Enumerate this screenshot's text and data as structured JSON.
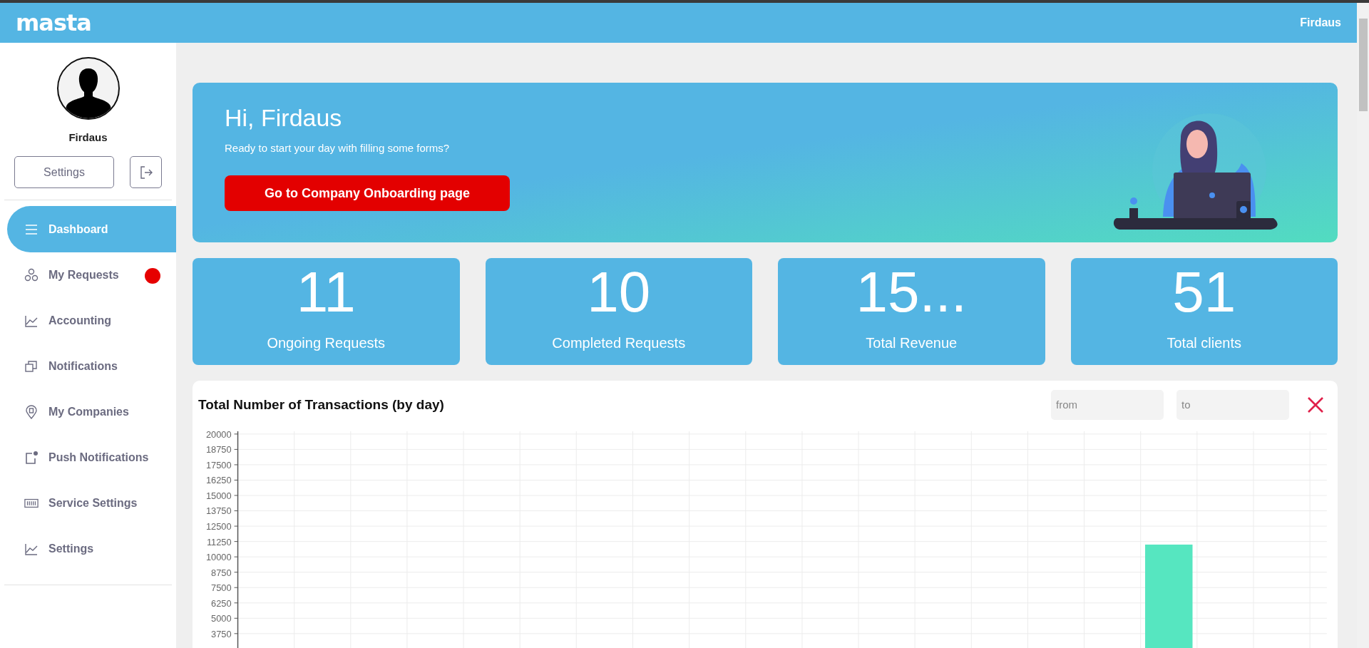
{
  "header": {
    "logo": "masta",
    "user_name": "Firdaus"
  },
  "profile": {
    "name": "Firdaus",
    "settings_button": "Settings"
  },
  "nav": [
    {
      "label": "Dashboard",
      "kind": "menu",
      "selected": true,
      "alert": false
    },
    {
      "label": "My Requests",
      "kind": "circles",
      "selected": false,
      "alert": true
    },
    {
      "label": "Accounting",
      "kind": "chart",
      "selected": false,
      "alert": false
    },
    {
      "label": "Notifications",
      "kind": "squares",
      "selected": false,
      "alert": false
    },
    {
      "label": "My Companies",
      "kind": "pin",
      "selected": false,
      "alert": false
    },
    {
      "label": "Push Notifications",
      "kind": "boxdot",
      "selected": false,
      "alert": false
    },
    {
      "label": "Service Settings",
      "kind": "barcode",
      "selected": false,
      "alert": false
    },
    {
      "label": "Settings",
      "kind": "chart",
      "selected": false,
      "alert": false
    }
  ],
  "banner": {
    "greeting": "Hi, Firdaus",
    "subtitle": "Ready to start your day with filling some forms?",
    "button": "Go to Company Onboarding page"
  },
  "stats": [
    {
      "value": "11",
      "label": "Ongoing Requests"
    },
    {
      "value": "10",
      "label": "Completed Requests"
    },
    {
      "value": "15...",
      "label": "Total Revenue"
    },
    {
      "value": "51",
      "label": "Total clients"
    }
  ],
  "transactions": {
    "title": "Total Number of Transactions (by day)",
    "from_placeholder": "from",
    "to_placeholder": "to",
    "chart_data": {
      "type": "bar",
      "grid": true,
      "ylim": [
        0,
        20000
      ],
      "yticks": [
        3750,
        5000,
        6250,
        7500,
        8750,
        10000,
        11250,
        12500,
        13750,
        15000,
        16250,
        17500,
        18750,
        20000
      ],
      "series": [
        {
          "color": "#56e6c0",
          "values": [
            0,
            0,
            0,
            0,
            0,
            0,
            0,
            0,
            0,
            0,
            0,
            0,
            0,
            0,
            0,
            0,
            11000,
            0,
            0
          ]
        }
      ]
    }
  }
}
